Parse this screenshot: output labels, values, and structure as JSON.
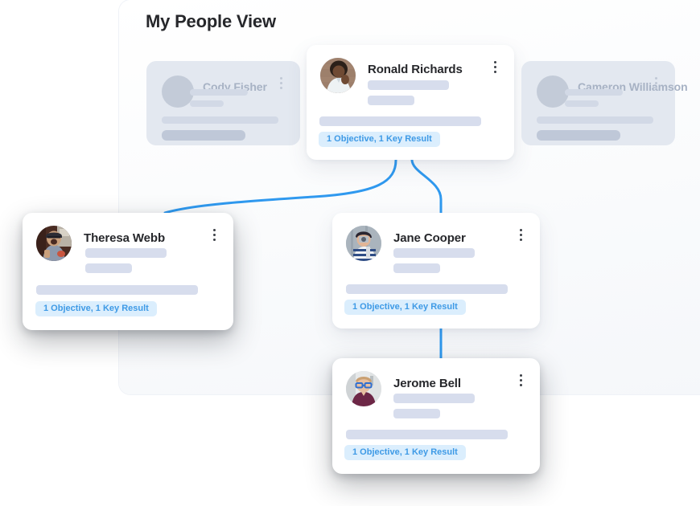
{
  "panel": {
    "title": "My People View",
    "background": "#fbfcfd",
    "accent": "#2f99ef"
  },
  "badge_style": {
    "background": "#dbeefd",
    "text_color": "#3e9ae6"
  },
  "cards": {
    "cody": {
      "name": "Cody Fisher",
      "state": "faded",
      "avatar": "placeholder-avatar",
      "menu": "more-options-icon",
      "badge": ""
    },
    "ronald": {
      "name": "Ronald Richards",
      "state": "active",
      "avatar": "photo-avatar",
      "menu": "more-options-icon",
      "badge": "1 Objective, 1 Key Result"
    },
    "cameron": {
      "name": "Cameron Williamson",
      "state": "faded",
      "avatar": "placeholder-avatar",
      "menu": "more-options-icon",
      "badge": ""
    },
    "theresa": {
      "name": "Theresa Webb",
      "state": "active",
      "avatar": "photo-avatar",
      "menu": "more-options-icon",
      "badge": "1 Objective, 1 Key Result"
    },
    "jane": {
      "name": "Jane Cooper",
      "state": "active",
      "avatar": "photo-avatar",
      "menu": "more-options-icon",
      "badge": "1 Objective, 1 Key Result"
    },
    "jerome": {
      "name": "Jerome Bell",
      "state": "active",
      "avatar": "photo-avatar",
      "menu": "more-options-icon",
      "badge": "1 Objective, 1 Key Result"
    }
  }
}
